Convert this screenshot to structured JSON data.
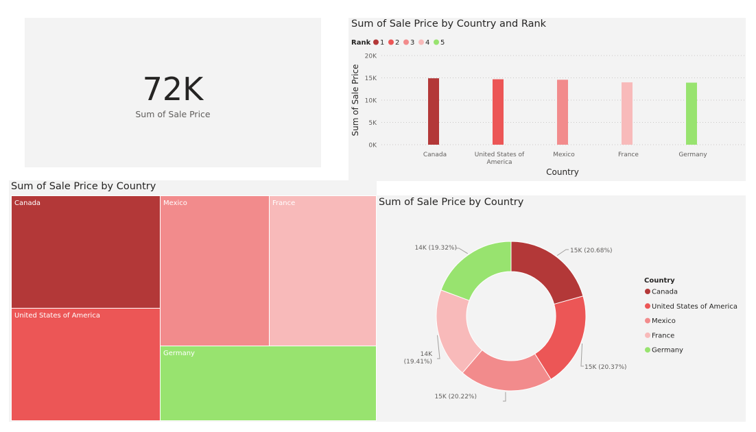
{
  "card": {
    "value": "72K",
    "label": "Sum of Sale Price"
  },
  "palette": {
    "Canada": "#b33838",
    "United States of America": "#ec5656",
    "Mexico": "#f28b8c",
    "France": "#f8baba",
    "Germany": "#98e36f"
  },
  "chart_data": [
    {
      "type": "bar",
      "title": "Sum of Sale Price by Country and Rank",
      "legend_title": "Rank",
      "legend": [
        "1",
        "2",
        "3",
        "4",
        "5"
      ],
      "legend_colors": [
        "#b33838",
        "#ec5656",
        "#f28b8c",
        "#f8baba",
        "#98e36f"
      ],
      "legend_position": "top-left",
      "xlabel": "Country",
      "ylabel": "Sum of Sale Price",
      "categories": [
        "Canada",
        "United States of America",
        "Mexico",
        "France",
        "Germany"
      ],
      "category_lines": [
        [
          "Canada"
        ],
        [
          "United States of",
          "America"
        ],
        [
          "Mexico"
        ],
        [
          "France"
        ],
        [
          "Germany"
        ]
      ],
      "values": [
        14900,
        14680,
        14570,
        13990,
        13920
      ],
      "ylim": [
        0,
        20000
      ],
      "yticks": [
        0,
        5000,
        10000,
        15000,
        20000
      ],
      "ytick_labels": [
        "0K",
        "5K",
        "10K",
        "15K",
        "20K"
      ],
      "grid": true
    },
    {
      "type": "treemap",
      "title": "Sum of Sale Price by Country",
      "categories": [
        "Canada",
        "United States of America",
        "Mexico",
        "France",
        "Germany"
      ],
      "values": [
        14900,
        14680,
        14570,
        13990,
        13920
      ]
    },
    {
      "type": "pie",
      "donut": true,
      "title": "Sum of Sale Price by Country",
      "legend_title": "Country",
      "legend_position": "right",
      "categories": [
        "Canada",
        "United States of America",
        "Mexico",
        "France",
        "Germany"
      ],
      "values": [
        14900,
        14680,
        14570,
        13990,
        13920
      ],
      "percents": [
        20.68,
        20.37,
        20.22,
        19.41,
        19.32
      ],
      "data_labels": [
        [
          "15K (20.68%)"
        ],
        [
          "15K (20.37%)"
        ],
        [
          "15K (20.22%)"
        ],
        [
          "14K",
          "(19.41%)"
        ],
        [
          "14K (19.32%)"
        ]
      ]
    }
  ]
}
